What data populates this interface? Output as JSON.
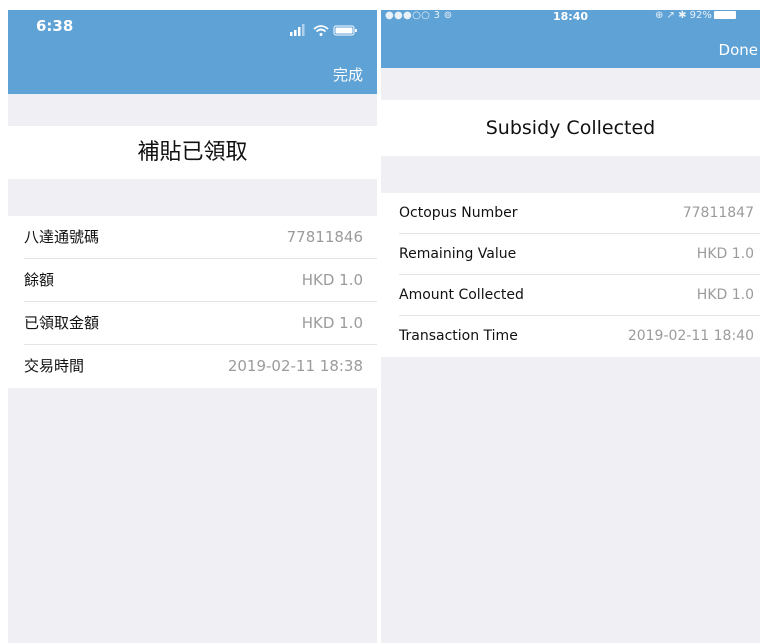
{
  "screens": {
    "left": {
      "status": {
        "time": "6:38"
      },
      "nav": {
        "done_label": "完成"
      },
      "title": "補貼已領取",
      "rows": [
        {
          "label": "八達通號碼",
          "value": "77811846"
        },
        {
          "label": "餘額",
          "value": "HKD 1.0"
        },
        {
          "label": "已領取金額",
          "value": "HKD 1.0"
        },
        {
          "label": "交易時間",
          "value": "2019-02-11 18:38"
        }
      ]
    },
    "right": {
      "status": {
        "carrier": "●●●○○ 3 ⊚",
        "time": "18:40",
        "icons": "⊕ ↗ ✱ 92%"
      },
      "nav": {
        "done_label": "Done"
      },
      "title": "Subsidy Collected",
      "rows": [
        {
          "label": "Octopus Number",
          "value": "77811847"
        },
        {
          "label": "Remaining Value",
          "value": "HKD 1.0"
        },
        {
          "label": "Amount Collected",
          "value": "HKD 1.0"
        },
        {
          "label": "Transaction Time",
          "value": "2019-02-11 18:40"
        }
      ]
    }
  },
  "colors": {
    "nav_blue": "#5ea2d6",
    "background_gray": "#efeff4",
    "value_gray": "#9b9b9b"
  },
  "icons": {
    "left_status": [
      "signal-bars-icon",
      "wifi-icon",
      "battery-icon"
    ],
    "right_status": [
      "signal-dots-icon",
      "location-icon",
      "bluetooth-icon",
      "battery-icon"
    ]
  }
}
